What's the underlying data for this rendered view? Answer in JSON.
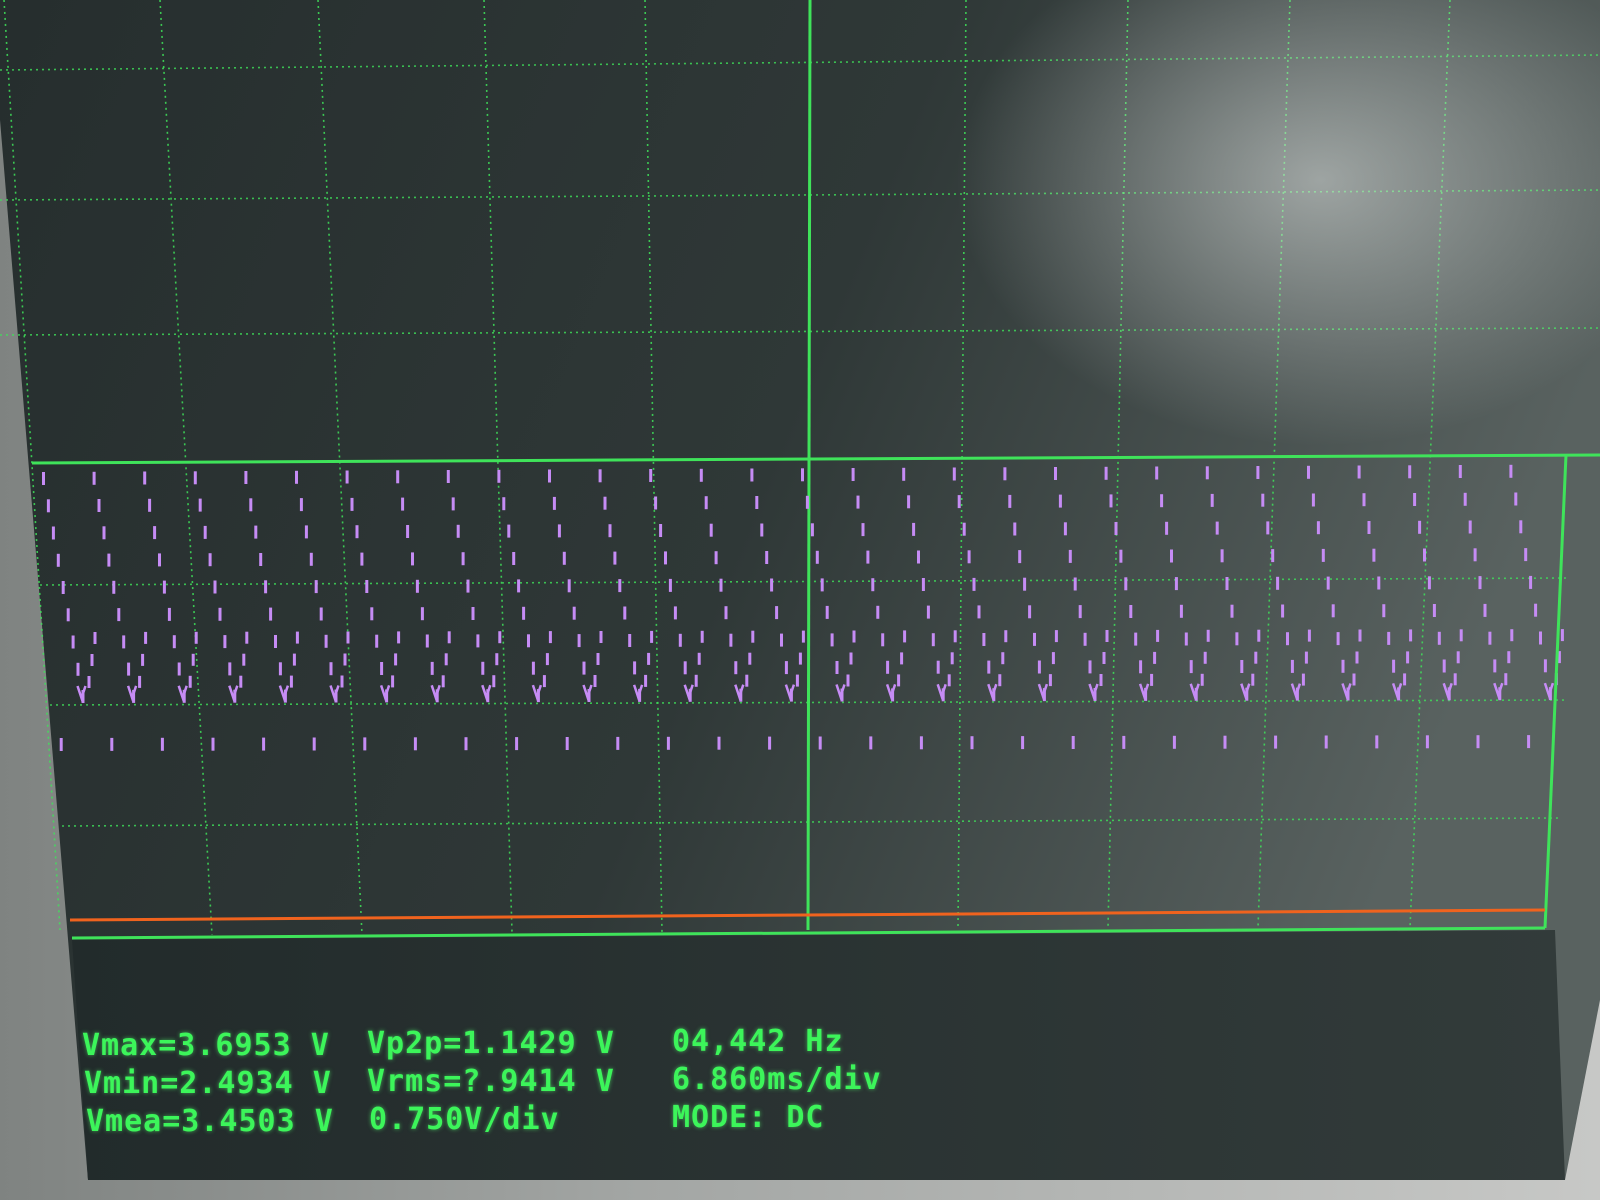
{
  "scope": {
    "readout": {
      "vmax": "Vmax=3.6953 V",
      "vmin": "Vmin=2.4934 V",
      "vmean": "Vmea=3.4503 V",
      "vp2p": "Vp2p=1.1429 V",
      "vrms": "Vrms=?.9414 V",
      "volts_per_div": "0.750V/div",
      "frequency": "04,442 Hz",
      "time_per_div": "6.860ms/div",
      "mode": "MODE: DC"
    },
    "colors": {
      "grid": "#3fe35a",
      "trace": "#c68cf5",
      "ground_marker": "#f0631e",
      "text": "#3cf55a",
      "screen_background": "#2b3434"
    }
  }
}
